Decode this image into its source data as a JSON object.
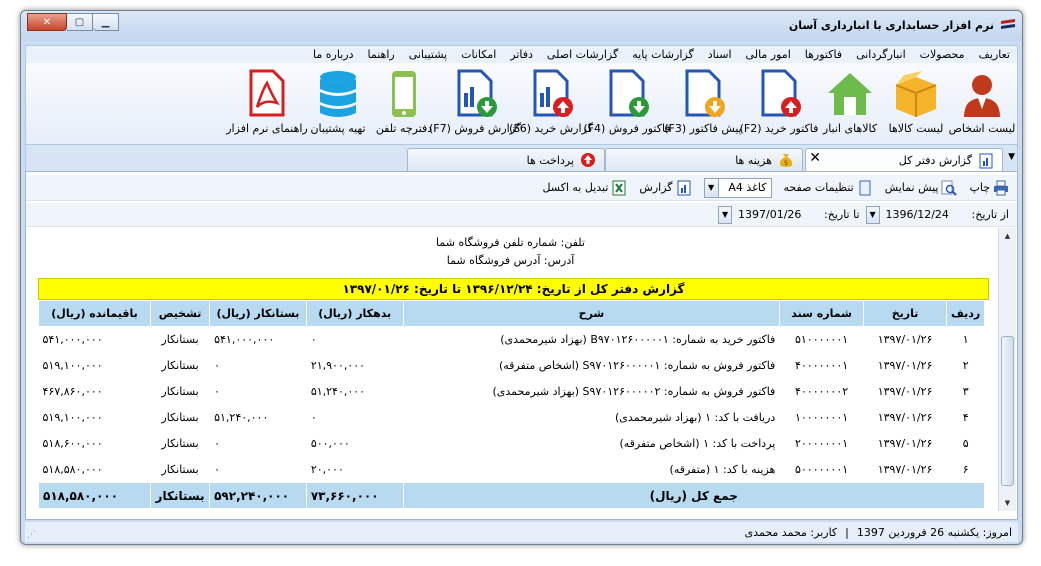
{
  "window": {
    "title": "نرم افزار حسابداری با انبارداری آسان",
    "controls": {
      "close": "✕",
      "maximize": "▢",
      "minimize": "▁"
    }
  },
  "menu": [
    "تعاریف",
    "محصولات",
    "انبارگردانی",
    "فاکتورها",
    "امور مالی",
    "اسناد",
    "گزارشات پایه",
    "گزارشات اصلی",
    "دفاتر",
    "امکانات",
    "پشتیبانی",
    "راهنما",
    "درباره ما"
  ],
  "ribbon": [
    {
      "label": "لیست اشخاص",
      "icon": "person-icon"
    },
    {
      "label": "لیست کالاها",
      "icon": "box-icon"
    },
    {
      "label": "کالاهای انبار",
      "icon": "warehouse-icon"
    },
    {
      "label": "فاکتور خرید (F2)",
      "icon": "purchase-invoice-icon"
    },
    {
      "label": "پیش فاکتور (F3)",
      "icon": "proforma-invoice-icon"
    },
    {
      "label": "فاکتور فروش (F4)",
      "icon": "sales-invoice-icon"
    },
    {
      "label": "گزارش خرید (F6)",
      "icon": "purchase-report-icon"
    },
    {
      "label": "گزارش فروش (F7)",
      "icon": "sales-report-icon"
    },
    {
      "label": "دفترچه تلفن",
      "icon": "phone-icon"
    },
    {
      "label": "تهیه پشتیبان",
      "icon": "database-icon"
    },
    {
      "label": "راهنمای نرم افزار",
      "icon": "pdf-icon"
    }
  ],
  "tabs": [
    {
      "label": "گزارش دفتر کل",
      "active": true
    },
    {
      "label": "هزینه ها",
      "active": false
    },
    {
      "label": "پرداخت ها",
      "active": false
    }
  ],
  "toolbar": {
    "print": "چاپ",
    "preview": "پیش نمایش",
    "page_settings": "تنظیمات صفحه",
    "paper_label": "کاغذ",
    "paper_value": "A4",
    "report": "گزارش",
    "excel": "تبدیل به اکسل"
  },
  "filter": {
    "from_label": "از تاریخ:",
    "from_value": "1396/12/24",
    "to_label": "تا تاریخ:",
    "to_value": "1397/01/26"
  },
  "report": {
    "phone": "تلفن: شماره تلفن فروشگاه شما",
    "address": "آدرس: آدرس فروشگاه شما",
    "title": "گزارش دفتر کل از تاریخ: ۱۳۹۶/۱۲/۲۴ تا تاریخ: ۱۳۹۷/۰۱/۲۶",
    "columns": [
      "ردیف",
      "تاریخ",
      "شماره سند",
      "شرح",
      "بدهکار (ریال)",
      "بستانکار (ریال)",
      "تشخیص",
      "باقیمانده (ریال)"
    ],
    "rows": [
      [
        "۱",
        "۱۳۹۷/۰۱/۲۶",
        "۵۱۰۰۰۰۰۰۱",
        "فاکتور خرید به شماره: B۹۷۰۱۲۶۰۰۰۰۰۱ (بهزاد شیرمحمدی)",
        "۰",
        "۵۴۱,۰۰۰,۰۰۰",
        "بستانکار",
        "۵۴۱,۰۰۰,۰۰۰"
      ],
      [
        "۲",
        "۱۳۹۷/۰۱/۲۶",
        "۴۰۰۰۰۰۰۰۱",
        "فاکتور فروش به شماره: S۹۷۰۱۲۶۰۰۰۰۰۱ (اشخاص متفرقه)",
        "۲۱,۹۰۰,۰۰۰",
        "۰",
        "بستانکار",
        "۵۱۹,۱۰۰,۰۰۰"
      ],
      [
        "۳",
        "۱۳۹۷/۰۱/۲۶",
        "۴۰۰۰۰۰۰۰۲",
        "فاکتور فروش به شماره: S۹۷۰۱۲۶۰۰۰۰۰۲ (بهزاد شیرمحمدی)",
        "۵۱,۲۴۰,۰۰۰",
        "۰",
        "بستانکار",
        "۴۶۷,۸۶۰,۰۰۰"
      ],
      [
        "۴",
        "۱۳۹۷/۰۱/۲۶",
        "۱۰۰۰۰۰۰۰۱",
        "دریافت با کد: ۱ (بهزاد شیرمحمدی)",
        "۰",
        "۵۱,۲۴۰,۰۰۰",
        "بستانکار",
        "۵۱۹,۱۰۰,۰۰۰"
      ],
      [
        "۵",
        "۱۳۹۷/۰۱/۲۶",
        "۲۰۰۰۰۰۰۰۱",
        "پرداخت با کد: ۱ (اشخاص متفرقه)",
        "۵۰۰,۰۰۰",
        "۰",
        "بستانکار",
        "۵۱۸,۶۰۰,۰۰۰"
      ],
      [
        "۶",
        "۱۳۹۷/۰۱/۲۶",
        "۵۰۰۰۰۰۰۰۱",
        "هزینه با کد: ۱ (متفرقه)",
        "۲۰,۰۰۰",
        "۰",
        "بستانکار",
        "۵۱۸,۵۸۰,۰۰۰"
      ]
    ],
    "total": {
      "label": "جمع کل (ریال)",
      "debit": "۷۳,۶۶۰,۰۰۰",
      "credit": "۵۹۲,۲۴۰,۰۰۰",
      "status": "بستانکار",
      "balance": "۵۱۸,۵۸۰,۰۰۰"
    }
  },
  "status": {
    "today": "امروز: یکشنبه 26 فروردین 1397",
    "separator": "|",
    "user": "کاربر: محمد محمدی"
  },
  "colors": {
    "header_bg": "#b8daf0",
    "title_bg": "#ffff00",
    "window_bg": "#c9dcf1"
  }
}
